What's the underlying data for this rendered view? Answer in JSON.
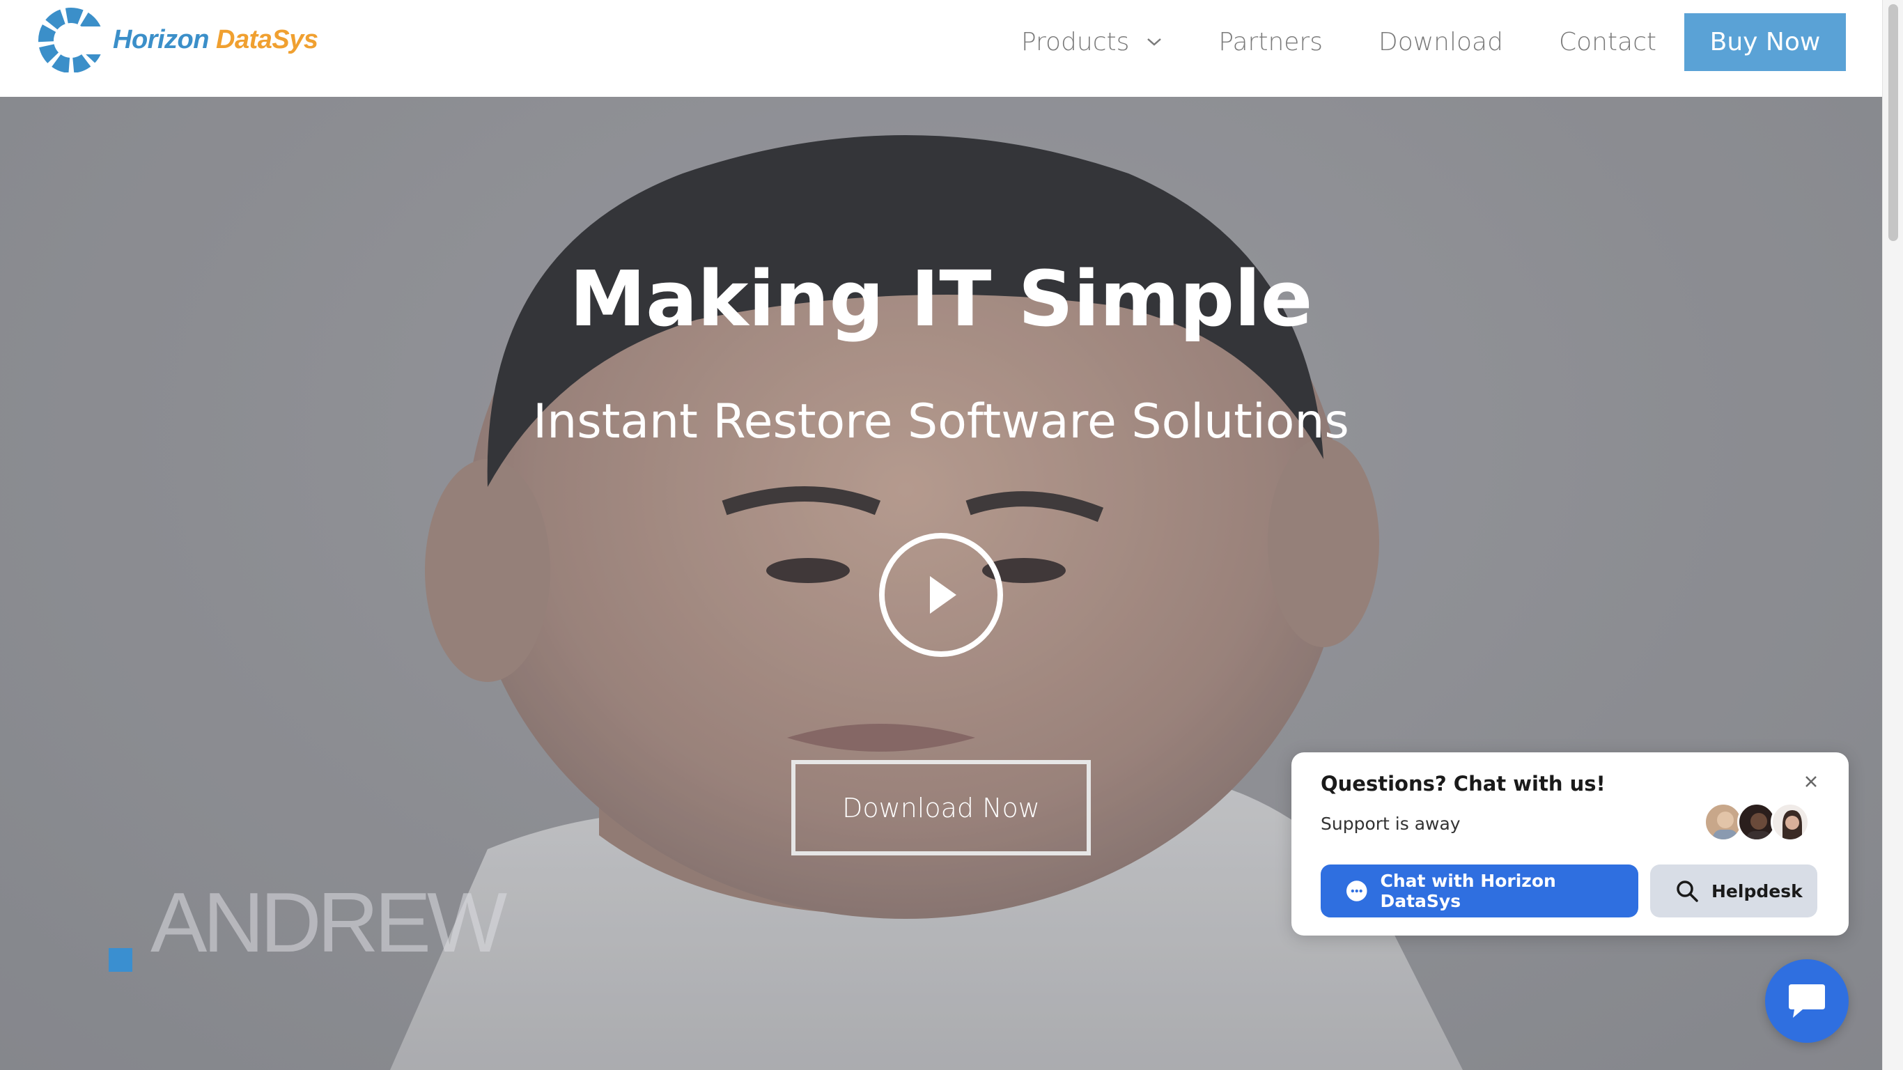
{
  "brand": {
    "name_part1": "Horizon",
    "name_part2": "DataSys",
    "color_primary": "#3b8fc9",
    "color_secondary": "#f0a030"
  },
  "nav": {
    "items": [
      {
        "label": "Products",
        "has_dropdown": true
      },
      {
        "label": "Partners"
      },
      {
        "label": "Download"
      },
      {
        "label": "Contact"
      }
    ],
    "buy_label": "Buy Now",
    "buy_color": "#5aa2d6"
  },
  "hero": {
    "title": "Making IT Simple",
    "subtitle": "Instant Restore Software Solutions",
    "play_icon": "play-icon",
    "cta_label": "Download Now",
    "video_caption": "ANDREW"
  },
  "chat_widget": {
    "title": "Questions? Chat with us!",
    "status": "Support is away",
    "chat_button_label": "Chat with Horizon DataSys",
    "helpdesk_label": "Helpdesk",
    "accent_color": "#2f6fe0",
    "agent_avatars": 3
  }
}
